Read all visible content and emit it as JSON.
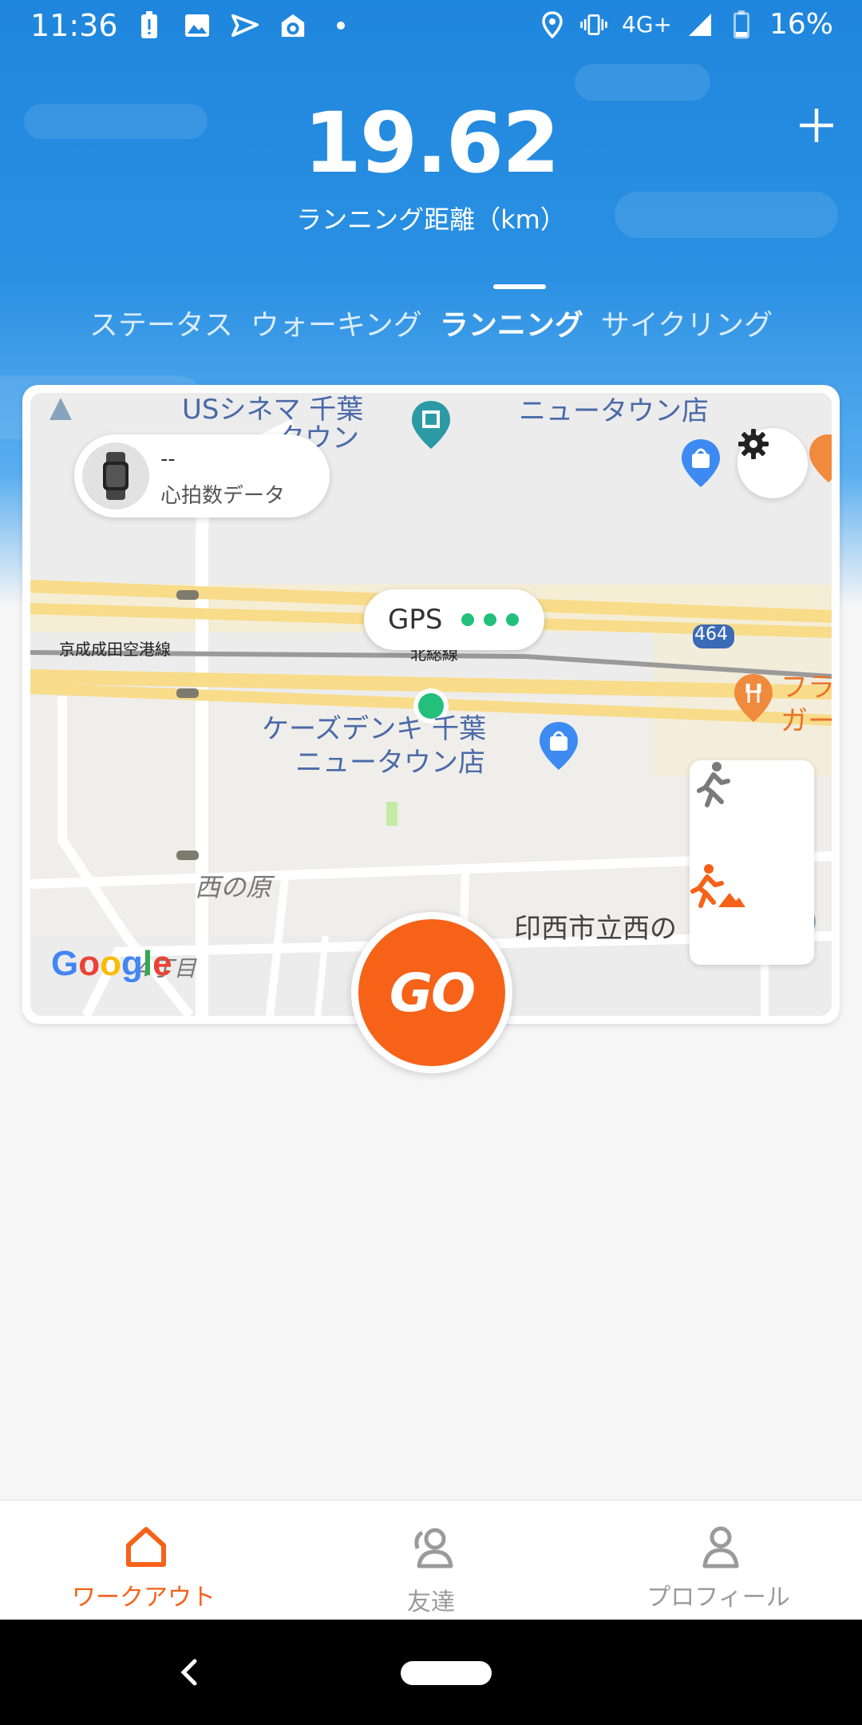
{
  "status_bar": {
    "time": "11:36",
    "network": "4G+",
    "battery": "16%",
    "icons_left": [
      "battery-alert-icon",
      "image-icon",
      "send-icon",
      "soccer-icon",
      "dot-icon"
    ],
    "icons_right": [
      "location-icon",
      "vibrate-icon",
      "network-icon",
      "signal-icon",
      "battery-icon"
    ]
  },
  "header": {
    "distance_value": "19.62",
    "distance_label": "ランニング距離（km）",
    "add_icon": "plus-icon"
  },
  "tabs": [
    {
      "label": "ステータス",
      "active": false
    },
    {
      "label": "ウォーキング",
      "active": false
    },
    {
      "label": "ランニング",
      "active": true
    },
    {
      "label": "サイクリング",
      "active": false
    }
  ],
  "map": {
    "heart_rate": {
      "value": "--",
      "label": "心拍数データ"
    },
    "gps": {
      "label": "GPS",
      "signal_dots": 3,
      "color": "#22c07a"
    },
    "labels": {
      "cinema": "USシネマ 千葉",
      "cinema2": "タウン",
      "newtown": "ニュータウン店",
      "keisei": "京成成田空港線",
      "hokuso": "北総線",
      "route": "464",
      "ks_denki": "ケーズデンキ 千葉",
      "ks_denki2": "ニュータウン店",
      "nishinohara": "西の原",
      "inzai": "印西市立西の",
      "chome": "4丁目",
      "restaurant1": "フラ",
      "restaurant2": "ガー",
      "google": "Google"
    },
    "modes": [
      "run-icon",
      "trail-run-icon"
    ],
    "accent": "#f56218"
  },
  "go_button": {
    "label": "GO"
  },
  "bottom_nav": [
    {
      "label": "ワークアウト",
      "icon": "home-icon",
      "active": true
    },
    {
      "label": "友達",
      "icon": "friends-icon",
      "active": false
    },
    {
      "label": "プロフィール",
      "icon": "profile-icon",
      "active": false
    }
  ]
}
